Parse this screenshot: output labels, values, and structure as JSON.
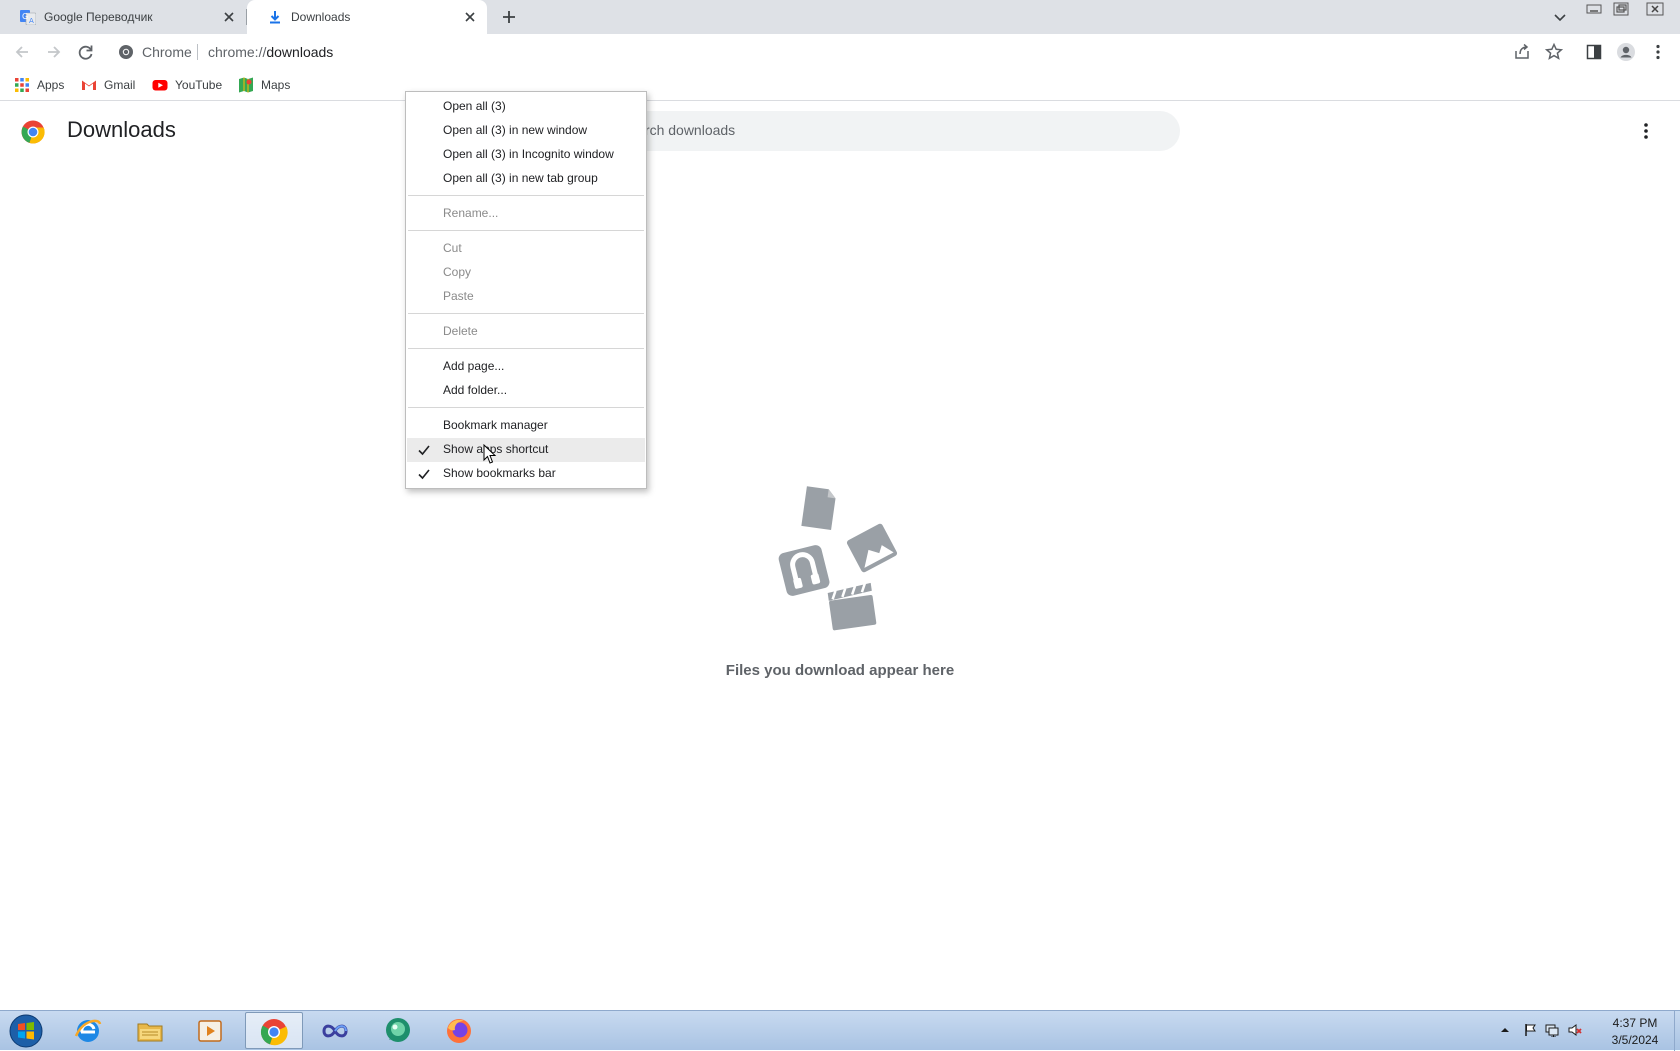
{
  "browser": {
    "tabs": [
      {
        "title": "Google Переводчик",
        "icon": "google-translate-icon",
        "active": false
      },
      {
        "title": "Downloads",
        "icon": "download-icon",
        "active": true
      }
    ],
    "site_chip": "Chrome",
    "url_scheme": "chrome://",
    "url_host": "downloads"
  },
  "bookmarks": [
    {
      "label": "Apps",
      "icon": "apps-grid-icon"
    },
    {
      "label": "Gmail",
      "icon": "gmail-icon"
    },
    {
      "label": "YouTube",
      "icon": "youtube-icon"
    },
    {
      "label": "Maps",
      "icon": "maps-icon"
    }
  ],
  "page": {
    "title": "Downloads",
    "search_placeholder": "Search downloads",
    "empty_message": "Files you download appear here"
  },
  "context_menu": {
    "items": [
      {
        "label": "Open all (3)",
        "enabled": true,
        "checked": false
      },
      {
        "label": "Open all (3) in new window",
        "enabled": true,
        "checked": false
      },
      {
        "label": "Open all (3) in Incognito window",
        "enabled": true,
        "checked": false
      },
      {
        "label": "Open all (3) in new tab group",
        "enabled": true,
        "checked": false
      },
      {
        "label": "Rename...",
        "enabled": false,
        "checked": false
      },
      {
        "label": "Cut",
        "enabled": false,
        "checked": false
      },
      {
        "label": "Copy",
        "enabled": false,
        "checked": false
      },
      {
        "label": "Paste",
        "enabled": false,
        "checked": false
      },
      {
        "label": "Delete",
        "enabled": false,
        "checked": false
      },
      {
        "label": "Add page...",
        "enabled": true,
        "checked": false
      },
      {
        "label": "Add folder...",
        "enabled": true,
        "checked": false
      },
      {
        "label": "Bookmark manager",
        "enabled": true,
        "checked": false
      },
      {
        "label": "Show apps shortcut",
        "enabled": true,
        "checked": true,
        "hovered": true
      },
      {
        "label": "Show bookmarks bar",
        "enabled": true,
        "checked": true
      }
    ]
  },
  "taskbar": {
    "apps": [
      "internet-explorer-icon",
      "file-explorer-icon",
      "media-player-icon",
      "chrome-icon",
      "infinity-app-icon",
      "green-bubble-app-icon",
      "firefox-icon"
    ],
    "active_app": "chrome-icon",
    "clock_time": "4:37 PM",
    "clock_date": "3/5/2024"
  },
  "colors": {
    "tabstrip": "#dee1e6",
    "taskbar": "#a9c3e3",
    "illustration": "#9aa0a6",
    "menu_hover": "#ebebeb"
  }
}
